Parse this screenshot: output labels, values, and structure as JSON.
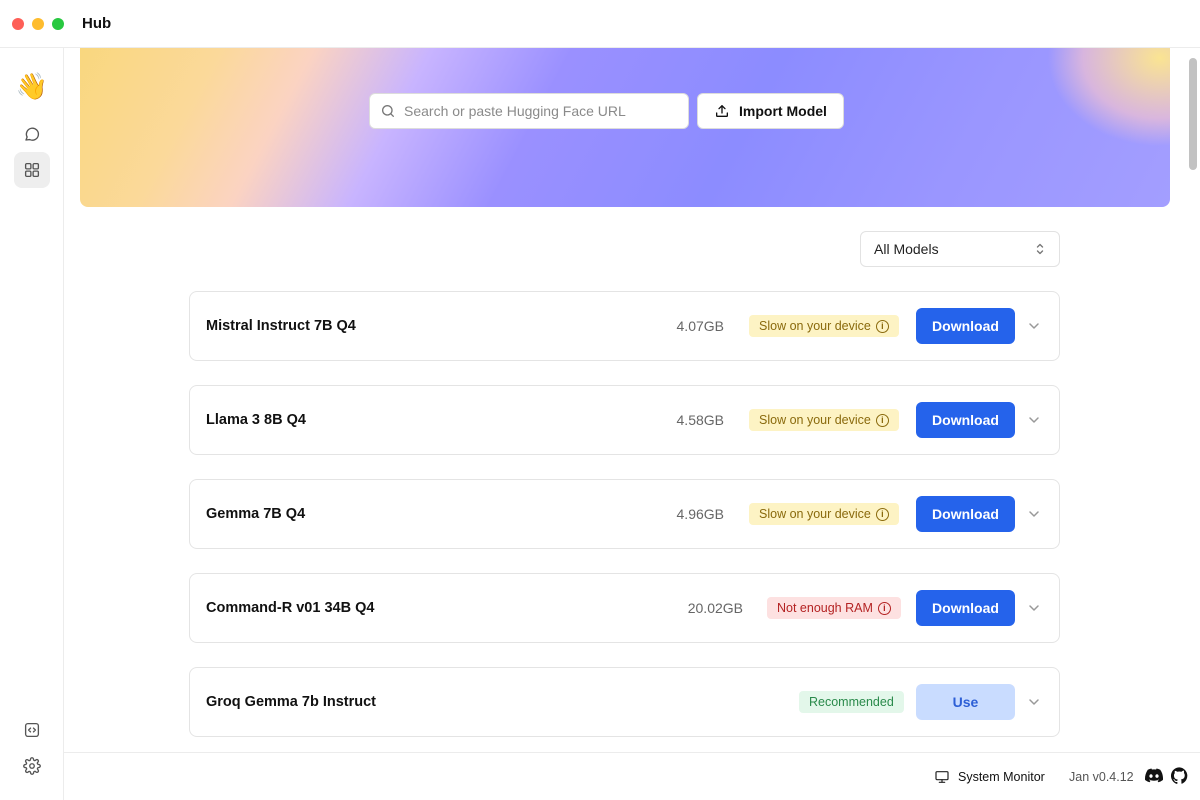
{
  "window": {
    "title": "Hub"
  },
  "search": {
    "placeholder": "Search or paste Hugging Face URL"
  },
  "toolbar": {
    "import_label": "Import Model"
  },
  "filter": {
    "selected": "All Models"
  },
  "models": [
    {
      "name": "Mistral Instruct 7B Q4",
      "size": "4.07GB",
      "badge": "Slow on your device",
      "badge_type": "slow",
      "action": "Download"
    },
    {
      "name": "Llama 3 8B Q4",
      "size": "4.58GB",
      "badge": "Slow on your device",
      "badge_type": "slow",
      "action": "Download"
    },
    {
      "name": "Gemma 7B Q4",
      "size": "4.96GB",
      "badge": "Slow on your device",
      "badge_type": "slow",
      "action": "Download"
    },
    {
      "name": "Command-R v01 34B Q4",
      "size": "20.02GB",
      "badge": "Not enough RAM",
      "badge_type": "ram",
      "action": "Download"
    },
    {
      "name": "Groq Gemma 7b Instruct",
      "size": "",
      "badge": "Recommended",
      "badge_type": "rec",
      "action": "Use"
    }
  ],
  "footer": {
    "system_monitor": "System Monitor",
    "version": "Jan v0.4.12"
  },
  "colors": {
    "accent": "#2563eb",
    "slow_badge_bg": "#fdf3c4",
    "ram_badge_bg": "#fde1e1",
    "recommended_badge_bg": "#e3f7ea"
  },
  "icons": {
    "sidebar": [
      "waving-hand-icon",
      "chat-icon",
      "grid-icon",
      "code-icon",
      "gear-icon"
    ],
    "footer": [
      "monitor-icon",
      "discord-icon",
      "github-icon"
    ]
  }
}
